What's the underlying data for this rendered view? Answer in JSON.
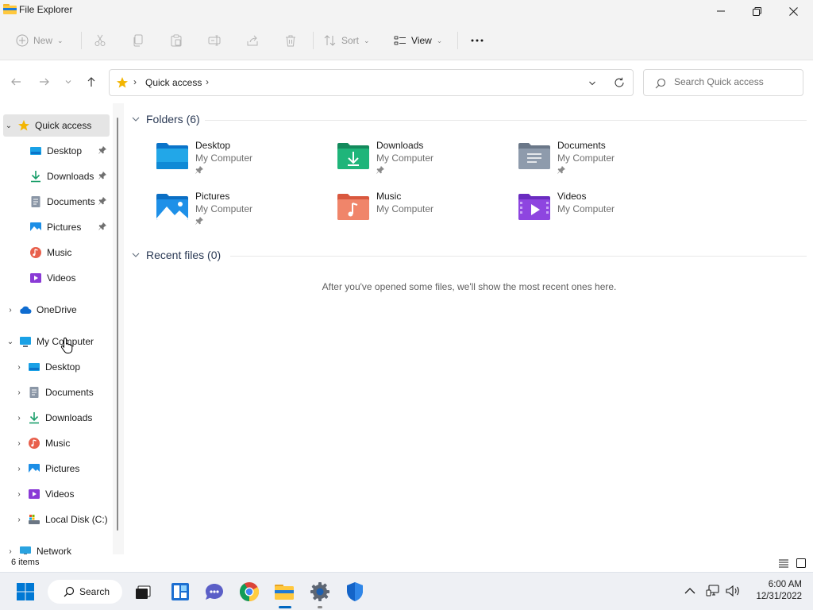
{
  "window": {
    "title": "File Explorer"
  },
  "toolbar": {
    "new_label": "New",
    "sort_label": "Sort",
    "view_label": "View"
  },
  "address": {
    "crumb": "Quick access",
    "search_placeholder": "Search Quick access"
  },
  "nav": {
    "quick_access": {
      "label": "Quick access",
      "items": [
        {
          "label": "Desktop",
          "pinned": true
        },
        {
          "label": "Downloads",
          "pinned": true
        },
        {
          "label": "Documents",
          "pinned": true
        },
        {
          "label": "Pictures",
          "pinned": true
        },
        {
          "label": "Music",
          "pinned": false
        },
        {
          "label": "Videos",
          "pinned": false
        }
      ]
    },
    "onedrive": {
      "label": "OneDrive"
    },
    "my_computer": {
      "label": "My Computer",
      "items": [
        {
          "label": "Desktop"
        },
        {
          "label": "Documents"
        },
        {
          "label": "Downloads"
        },
        {
          "label": "Music"
        },
        {
          "label": "Pictures"
        },
        {
          "label": "Videos"
        },
        {
          "label": "Local Disk (C:)"
        }
      ]
    },
    "network": {
      "label": "Network"
    }
  },
  "content": {
    "folders_header": "Folders (6)",
    "folders": [
      {
        "name": "Desktop",
        "location": "My Computer",
        "icon": "desktop-folder-icon"
      },
      {
        "name": "Downloads",
        "location": "My Computer",
        "icon": "downloads-folder-icon"
      },
      {
        "name": "Documents",
        "location": "My Computer",
        "icon": "documents-folder-icon"
      },
      {
        "name": "Pictures",
        "location": "My Computer",
        "icon": "pictures-folder-icon"
      },
      {
        "name": "Music",
        "location": "My Computer",
        "icon": "music-folder-icon"
      },
      {
        "name": "Videos",
        "location": "My Computer",
        "icon": "videos-folder-icon"
      }
    ],
    "recent_header": "Recent files (0)",
    "recent_empty": "After you've opened some files, we'll show the most recent ones here."
  },
  "status": {
    "items_count": "6 items"
  },
  "taskbar": {
    "search_label": "Search",
    "time": "6:00 AM",
    "date": "12/31/2022"
  },
  "colors": {
    "accent": "#0067c0",
    "star": "#f3b500",
    "selected_nav": "#e5e5e5"
  }
}
